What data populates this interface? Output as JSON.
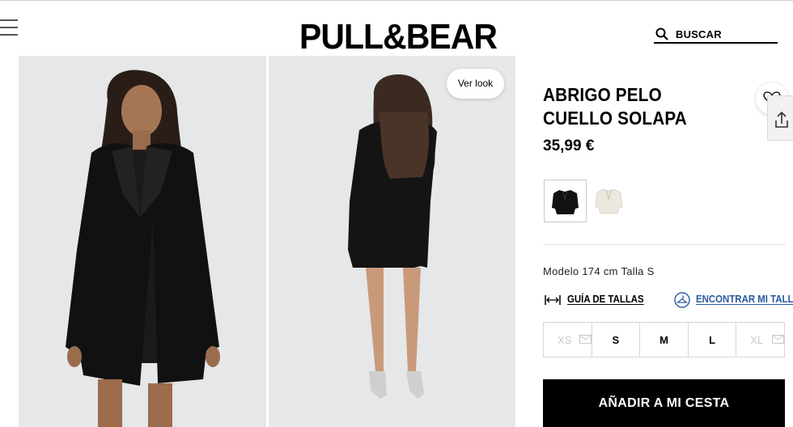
{
  "header": {
    "brand": "PULL&BEAR",
    "search_label": "BUSCAR"
  },
  "gallery": {
    "ver_look_label": "Ver look",
    "images": [
      {
        "alt": "front view",
        "icon": "product-photo-front"
      },
      {
        "alt": "back view",
        "icon": "product-photo-back"
      }
    ]
  },
  "product": {
    "name": "ABRIGO PELO CUELLO SOLAPA",
    "price": "35,99 €",
    "colors": [
      {
        "name": "black",
        "hex": "#111111",
        "selected": true
      },
      {
        "name": "ecru",
        "hex": "#ece7df",
        "selected": false
      }
    ],
    "model_info": "Modelo 174 cm Talla S",
    "size_guide_label": "GUÍA DE TALLAS",
    "find_size_label": "ENCONTRAR MI TALLA",
    "sizes": [
      {
        "label": "XS",
        "available": false
      },
      {
        "label": "S",
        "available": true
      },
      {
        "label": "M",
        "available": true
      },
      {
        "label": "L",
        "available": true
      },
      {
        "label": "XL",
        "available": false
      }
    ],
    "add_to_cart_label": "AÑADIR A MI CESTA"
  },
  "colors": {
    "link_blue": "#2c5aa0",
    "button_bg": "#000000",
    "photo_bg": "#e6e7e9",
    "unavailable_text": "#c7c7c7"
  }
}
